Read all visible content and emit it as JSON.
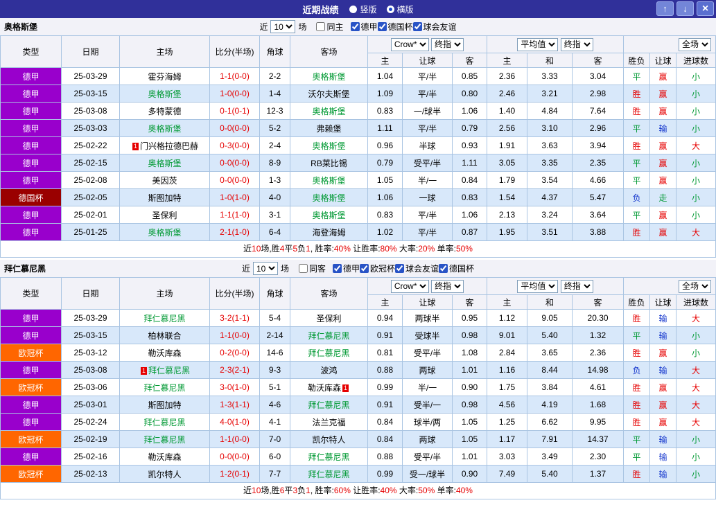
{
  "titlebar": {
    "title": "近期战绩",
    "vertical_label": "竖版",
    "horizontal_label": "横版",
    "up_icon": "↑",
    "down_icon": "↓",
    "close_icon": "×"
  },
  "columns": {
    "type": "类型",
    "date": "日期",
    "home": "主场",
    "score": "比分(半场)",
    "corners": "角球",
    "away": "客场",
    "odds_home": "主",
    "odds_handicap": "让球",
    "odds_away": "客",
    "avg_home": "主",
    "avg_draw": "和",
    "avg_away": "客",
    "wdl": "胜负",
    "handicap_result": "让球",
    "goals": "进球数"
  },
  "dropdowns": {
    "book": "Crow*",
    "final": "终指",
    "average": "平均值",
    "full": "全场"
  },
  "type_colors": {
    "德甲": "#9900cc",
    "德国杯": "#9a0000",
    "欧冠杯": "#ff6600"
  },
  "result_colors": {
    "胜": "#e60000",
    "平": "#009933",
    "负": "#1133cc",
    "赢": "#e60000",
    "走": "#009933",
    "输": "#1133cc",
    "大": "#e60000",
    "小": "#009933"
  },
  "highlight_color": "#009933",
  "sections": [
    {
      "team": "奥格斯堡",
      "recent_prefix": "近",
      "recent_count": "10",
      "recent_suffix": "场",
      "checkboxes": [
        {
          "label": "同主",
          "checked": false
        },
        {
          "label": "德甲",
          "checked": true
        },
        {
          "label": "德国杯",
          "checked": true
        },
        {
          "label": "球会友谊",
          "checked": true
        }
      ],
      "rows": [
        {
          "type": "德甲",
          "date": "25-03-29",
          "home": "霍芬海姆",
          "home_hl": false,
          "home_card": false,
          "score": "1-1(0-0)",
          "corners": "2-2",
          "away": "奥格斯堡",
          "away_hl": true,
          "away_card": false,
          "odds": [
            "1.04",
            "平/半",
            "0.85"
          ],
          "avg": [
            "2.36",
            "3.33",
            "3.04"
          ],
          "res": [
            "平",
            "赢",
            "小"
          ]
        },
        {
          "type": "德甲",
          "date": "25-03-15",
          "home": "奥格斯堡",
          "home_hl": true,
          "home_card": false,
          "score": "1-0(0-0)",
          "corners": "1-4",
          "away": "沃尔夫斯堡",
          "away_hl": false,
          "away_card": false,
          "odds": [
            "1.09",
            "平/半",
            "0.80"
          ],
          "avg": [
            "2.46",
            "3.21",
            "2.98"
          ],
          "res": [
            "胜",
            "赢",
            "小"
          ]
        },
        {
          "type": "德甲",
          "date": "25-03-08",
          "home": "多特蒙德",
          "home_hl": false,
          "home_card": false,
          "score": "0-1(0-1)",
          "corners": "12-3",
          "away": "奥格斯堡",
          "away_hl": true,
          "away_card": false,
          "odds": [
            "0.83",
            "一/球半",
            "1.06"
          ],
          "avg": [
            "1.40",
            "4.84",
            "7.64"
          ],
          "res": [
            "胜",
            "赢",
            "小"
          ]
        },
        {
          "type": "德甲",
          "date": "25-03-03",
          "home": "奥格斯堡",
          "home_hl": true,
          "home_card": false,
          "score": "0-0(0-0)",
          "corners": "5-2",
          "away": "弗赖堡",
          "away_hl": false,
          "away_card": false,
          "odds": [
            "1.11",
            "平/半",
            "0.79"
          ],
          "avg": [
            "2.56",
            "3.10",
            "2.96"
          ],
          "res": [
            "平",
            "输",
            "小"
          ]
        },
        {
          "type": "德甲",
          "date": "25-02-22",
          "home": "门兴格拉德巴赫",
          "home_hl": false,
          "home_card": true,
          "score": "0-3(0-0)",
          "corners": "2-4",
          "away": "奥格斯堡",
          "away_hl": true,
          "away_card": false,
          "odds": [
            "0.96",
            "半球",
            "0.93"
          ],
          "avg": [
            "1.91",
            "3.63",
            "3.94"
          ],
          "res": [
            "胜",
            "赢",
            "大"
          ]
        },
        {
          "type": "德甲",
          "date": "25-02-15",
          "home": "奥格斯堡",
          "home_hl": true,
          "home_card": false,
          "score": "0-0(0-0)",
          "corners": "8-9",
          "away": "RB莱比锡",
          "away_hl": false,
          "away_card": false,
          "odds": [
            "0.79",
            "受平/半",
            "1.11"
          ],
          "avg": [
            "3.05",
            "3.35",
            "2.35"
          ],
          "res": [
            "平",
            "赢",
            "小"
          ]
        },
        {
          "type": "德甲",
          "date": "25-02-08",
          "home": "美因茨",
          "home_hl": false,
          "home_card": false,
          "score": "0-0(0-0)",
          "corners": "1-3",
          "away": "奥格斯堡",
          "away_hl": true,
          "away_card": false,
          "odds": [
            "1.05",
            "半/一",
            "0.84"
          ],
          "avg": [
            "1.79",
            "3.54",
            "4.66"
          ],
          "res": [
            "平",
            "赢",
            "小"
          ]
        },
        {
          "type": "德国杯",
          "date": "25-02-05",
          "home": "斯图加特",
          "home_hl": false,
          "home_card": false,
          "score": "1-0(1-0)",
          "corners": "4-0",
          "away": "奥格斯堡",
          "away_hl": true,
          "away_card": false,
          "odds": [
            "1.06",
            "一球",
            "0.83"
          ],
          "avg": [
            "1.54",
            "4.37",
            "5.47"
          ],
          "res": [
            "负",
            "走",
            "小"
          ]
        },
        {
          "type": "德甲",
          "date": "25-02-01",
          "home": "圣保利",
          "home_hl": false,
          "home_card": false,
          "score": "1-1(1-0)",
          "corners": "3-1",
          "away": "奥格斯堡",
          "away_hl": true,
          "away_card": false,
          "odds": [
            "0.83",
            "平/半",
            "1.06"
          ],
          "avg": [
            "2.13",
            "3.24",
            "3.64"
          ],
          "res": [
            "平",
            "赢",
            "小"
          ]
        },
        {
          "type": "德甲",
          "date": "25-01-25",
          "home": "奥格斯堡",
          "home_hl": true,
          "home_card": false,
          "score": "2-1(1-0)",
          "corners": "6-4",
          "away": "海登海姆",
          "away_hl": false,
          "away_card": false,
          "odds": [
            "1.02",
            "平/半",
            "0.87"
          ],
          "avg": [
            "1.95",
            "3.51",
            "3.88"
          ],
          "res": [
            "胜",
            "赢",
            "大"
          ]
        }
      ],
      "summary": [
        {
          "t": "近"
        },
        {
          "t": "10",
          "c": "red"
        },
        {
          "t": "场,胜"
        },
        {
          "t": "4",
          "c": "red"
        },
        {
          "t": "平"
        },
        {
          "t": "5",
          "c": "red"
        },
        {
          "t": "负"
        },
        {
          "t": "1",
          "c": "red"
        },
        {
          "t": ", 胜率:"
        },
        {
          "t": "40%",
          "c": "red"
        },
        {
          "t": " 让胜率:"
        },
        {
          "t": "80%",
          "c": "red"
        },
        {
          "t": " 大率:"
        },
        {
          "t": "20%",
          "c": "red"
        },
        {
          "t": " 单率:"
        },
        {
          "t": "50%",
          "c": "red"
        }
      ]
    },
    {
      "team": "拜仁慕尼黑",
      "recent_prefix": "近",
      "recent_count": "10",
      "recent_suffix": "场",
      "checkboxes": [
        {
          "label": "同客",
          "checked": false
        },
        {
          "label": "德甲",
          "checked": true
        },
        {
          "label": "欧冠杯",
          "checked": true
        },
        {
          "label": "球会友谊",
          "checked": true
        },
        {
          "label": "德国杯",
          "checked": true
        }
      ],
      "rows": [
        {
          "type": "德甲",
          "date": "25-03-29",
          "home": "拜仁慕尼黑",
          "home_hl": true,
          "home_card": false,
          "score": "3-2(1-1)",
          "corners": "5-4",
          "away": "圣保利",
          "away_hl": false,
          "away_card": false,
          "odds": [
            "0.94",
            "两球半",
            "0.95"
          ],
          "avg": [
            "1.12",
            "9.05",
            "20.30"
          ],
          "res": [
            "胜",
            "输",
            "大"
          ]
        },
        {
          "type": "德甲",
          "date": "25-03-15",
          "home": "柏林联合",
          "home_hl": false,
          "home_card": false,
          "score": "1-1(0-0)",
          "corners": "2-14",
          "away": "拜仁慕尼黑",
          "away_hl": true,
          "away_card": false,
          "odds": [
            "0.91",
            "受球半",
            "0.98"
          ],
          "avg": [
            "9.01",
            "5.40",
            "1.32"
          ],
          "res": [
            "平",
            "输",
            "小"
          ]
        },
        {
          "type": "欧冠杯",
          "date": "25-03-12",
          "home": "勒沃库森",
          "home_hl": false,
          "home_card": false,
          "score": "0-2(0-0)",
          "corners": "14-6",
          "away": "拜仁慕尼黑",
          "away_hl": true,
          "away_card": false,
          "odds": [
            "0.81",
            "受平/半",
            "1.08"
          ],
          "avg": [
            "2.84",
            "3.65",
            "2.36"
          ],
          "res": [
            "胜",
            "赢",
            "小"
          ]
        },
        {
          "type": "德甲",
          "date": "25-03-08",
          "home": "拜仁慕尼黑",
          "home_hl": true,
          "home_card": true,
          "score": "2-3(2-1)",
          "corners": "9-3",
          "away": "波鸿",
          "away_hl": false,
          "away_card": false,
          "odds": [
            "0.88",
            "两球",
            "1.01"
          ],
          "avg": [
            "1.16",
            "8.44",
            "14.98"
          ],
          "res": [
            "负",
            "输",
            "大"
          ]
        },
        {
          "type": "欧冠杯",
          "date": "25-03-06",
          "home": "拜仁慕尼黑",
          "home_hl": true,
          "home_card": false,
          "score": "3-0(1-0)",
          "corners": "5-1",
          "away": "勒沃库森",
          "away_hl": false,
          "away_card": true,
          "odds": [
            "0.99",
            "半/一",
            "0.90"
          ],
          "avg": [
            "1.75",
            "3.84",
            "4.61"
          ],
          "res": [
            "胜",
            "赢",
            "大"
          ]
        },
        {
          "type": "德甲",
          "date": "25-03-01",
          "home": "斯图加特",
          "home_hl": false,
          "home_card": false,
          "score": "1-3(1-1)",
          "corners": "4-6",
          "away": "拜仁慕尼黑",
          "away_hl": true,
          "away_card": false,
          "odds": [
            "0.91",
            "受半/一",
            "0.98"
          ],
          "avg": [
            "4.56",
            "4.19",
            "1.68"
          ],
          "res": [
            "胜",
            "赢",
            "大"
          ]
        },
        {
          "type": "德甲",
          "date": "25-02-24",
          "home": "拜仁慕尼黑",
          "home_hl": true,
          "home_card": false,
          "score": "4-0(1-0)",
          "corners": "4-1",
          "away": "法兰克福",
          "away_hl": false,
          "away_card": false,
          "odds": [
            "0.84",
            "球半/两",
            "1.05"
          ],
          "avg": [
            "1.25",
            "6.62",
            "9.95"
          ],
          "res": [
            "胜",
            "赢",
            "大"
          ]
        },
        {
          "type": "欧冠杯",
          "date": "25-02-19",
          "home": "拜仁慕尼黑",
          "home_hl": true,
          "home_card": false,
          "score": "1-1(0-0)",
          "corners": "7-0",
          "away": "凯尔特人",
          "away_hl": false,
          "away_card": false,
          "odds": [
            "0.84",
            "两球",
            "1.05"
          ],
          "avg": [
            "1.17",
            "7.91",
            "14.37"
          ],
          "res": [
            "平",
            "输",
            "小"
          ]
        },
        {
          "type": "德甲",
          "date": "25-02-16",
          "home": "勒沃库森",
          "home_hl": false,
          "home_card": false,
          "score": "0-0(0-0)",
          "corners": "6-0",
          "away": "拜仁慕尼黑",
          "away_hl": true,
          "away_card": false,
          "odds": [
            "0.88",
            "受平/半",
            "1.01"
          ],
          "avg": [
            "3.03",
            "3.49",
            "2.30"
          ],
          "res": [
            "平",
            "输",
            "小"
          ]
        },
        {
          "type": "欧冠杯",
          "date": "25-02-13",
          "home": "凯尔特人",
          "home_hl": false,
          "home_card": false,
          "score": "1-2(0-1)",
          "corners": "7-7",
          "away": "拜仁慕尼黑",
          "away_hl": true,
          "away_card": false,
          "odds": [
            "0.99",
            "受一/球半",
            "0.90"
          ],
          "avg": [
            "7.49",
            "5.40",
            "1.37"
          ],
          "res": [
            "胜",
            "输",
            "小"
          ]
        }
      ],
      "summary": [
        {
          "t": "近"
        },
        {
          "t": "10",
          "c": "red"
        },
        {
          "t": "场,胜"
        },
        {
          "t": "6",
          "c": "red"
        },
        {
          "t": "平"
        },
        {
          "t": "3",
          "c": "red"
        },
        {
          "t": "负"
        },
        {
          "t": "1",
          "c": "red"
        },
        {
          "t": ", 胜率:"
        },
        {
          "t": "60%",
          "c": "red"
        },
        {
          "t": " 让胜率:"
        },
        {
          "t": "40%",
          "c": "red"
        },
        {
          "t": " 大率:"
        },
        {
          "t": "50%",
          "c": "red"
        },
        {
          "t": " 单率:"
        },
        {
          "t": "40%",
          "c": "red"
        }
      ]
    }
  ]
}
